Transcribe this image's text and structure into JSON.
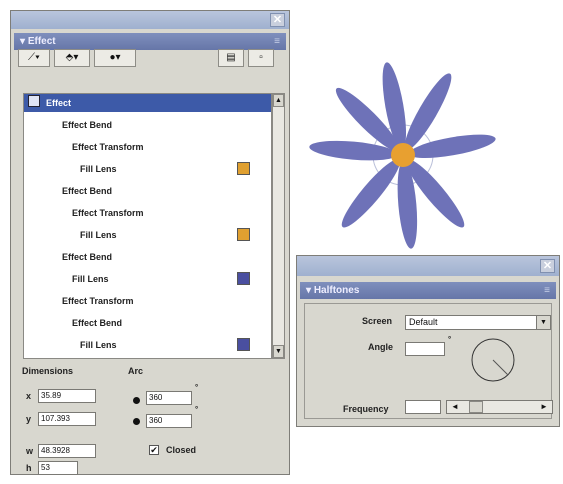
{
  "effect_panel": {
    "title": "Effect",
    "tree_items": [
      {
        "label": "Effect",
        "selected": true
      },
      {
        "label": "Effect Bend"
      },
      {
        "label": "Effect Transform"
      },
      {
        "label": "Fill Lens",
        "swatch": "#e0a030"
      },
      {
        "label": "Effect Bend"
      },
      {
        "label": "Effect Transform"
      },
      {
        "label": "Fill Lens",
        "swatch": "#e0a030"
      },
      {
        "label": "Effect Bend"
      },
      {
        "label": "Fill Lens",
        "swatch": "#4a4fa0"
      },
      {
        "label": "Effect Transform"
      },
      {
        "label": "Effect Bend"
      },
      {
        "label": "Fill Lens",
        "swatch": "#4a4fa0"
      }
    ],
    "dimensions_label": "Dimensions",
    "arc_label": "Arc",
    "x_label": "x",
    "x_value": "35.89",
    "y_label": "y",
    "y_value": "107.393",
    "w_label": "w",
    "w_value": "48.3928",
    "h_label": "h",
    "h_value": "53",
    "arc_start": "360",
    "arc_end": "360",
    "closed_label": "Closed",
    "closed_checked": "✔"
  },
  "halftones_panel": {
    "title": "Halftones",
    "screen_label": "Screen",
    "screen_value": "Default",
    "angle_label": "Angle",
    "angle_value": "",
    "frequency_label": "Frequency",
    "frequency_value": ""
  },
  "colors": {
    "petal": "#6e72b8",
    "center": "#e8a030",
    "selection": "#3d5aa8"
  }
}
